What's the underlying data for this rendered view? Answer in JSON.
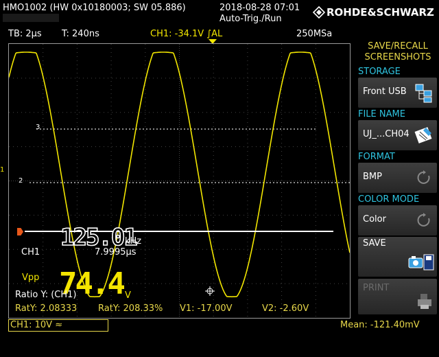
{
  "device": {
    "model_info": "HMO1002 (HW 0x10180003; SW 05.886)",
    "datetime": "2018-08-28 07:01",
    "trigger_mode": "Auto-Trig./Run",
    "brand": "ROHDE&SCHWARZ"
  },
  "status_bar": {
    "timebase": "TB: 2µs",
    "trig_time": "T: 240ns",
    "trigger": "CH1: -34.1V ∫AL",
    "sample_rate": "250MSa"
  },
  "markers": {
    "ref3": "3",
    "ref2": "2",
    "ch1": "1"
  },
  "measurements": {
    "freq_value": "125.01",
    "freq_unit": "kHz",
    "ch1_label": "CH1",
    "period": "7.9995µs",
    "vpp_label": "Vpp",
    "vpp_value": "74.4",
    "vpp_unit": "V",
    "ratio_label": "Ratio Y: (CH1)"
  },
  "bottom": {
    "raty1": "RatY: 2.08333",
    "raty2": "RatY: 208.33%",
    "v1": "V1: -17.00V",
    "v2": "V2: -2.60V",
    "ch1_scale": "CH1: 10V ≈",
    "mean": "Mean: -121.40mV"
  },
  "menu": {
    "title_line1": "SAVE/RECALL",
    "title_line2": "SCREENSHOTS",
    "storage_cap": "STORAGE",
    "storage_val": "Front USB",
    "filename_cap": "FILE NAME",
    "filename_val": "UJ_...CH04",
    "format_cap": "FORMAT",
    "format_val": "BMP",
    "colormode_cap": "COLOR MODE",
    "colormode_val": "Color",
    "save": "SAVE",
    "print": "PRINT"
  },
  "colors": {
    "trace": "#f2e600",
    "accent": "#2fc4e0",
    "panel": "#333333"
  }
}
